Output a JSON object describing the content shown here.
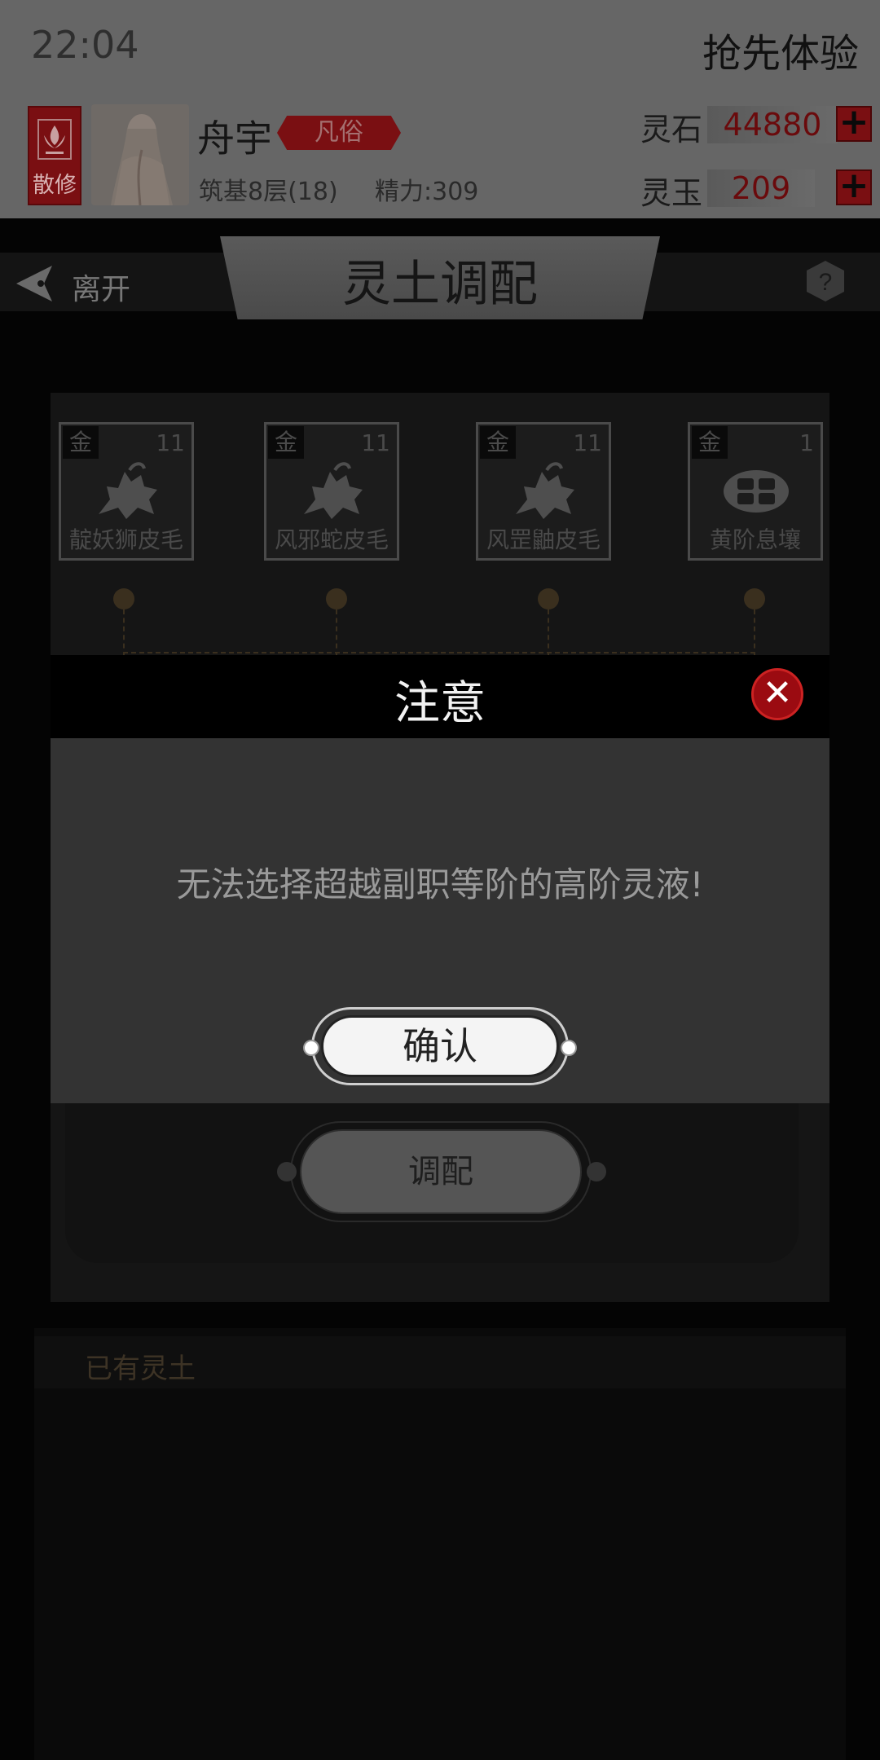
{
  "status": {
    "time": "22:04",
    "preview_label": "抢先体验"
  },
  "player": {
    "sect": "散修",
    "name": "舟宇",
    "rank": "凡俗",
    "realm": "筑基8层(18)",
    "energy": "精力:309"
  },
  "currency": [
    {
      "label": "灵石",
      "value": "44880"
    },
    {
      "label": "灵玉",
      "value": "209"
    }
  ],
  "header": {
    "back_label": "离开",
    "title": "灵土调配",
    "help_icon": "question-icon"
  },
  "slots": [
    {
      "grade": "金",
      "count": "11",
      "name": "靛妖狮皮毛",
      "icon": "beast-pelt-icon"
    },
    {
      "grade": "金",
      "count": "11",
      "name": "风邪蛇皮毛",
      "icon": "beast-pelt-icon"
    },
    {
      "grade": "金",
      "count": "11",
      "name": "风罡鼬皮毛",
      "icon": "beast-pelt-icon"
    },
    {
      "grade": "金",
      "count": "1",
      "name": "黄阶息壤",
      "icon": "soil-block-icon"
    }
  ],
  "mix_button": "调配",
  "owned": {
    "title": "已有灵土"
  },
  "modal": {
    "title": "注意",
    "message": "无法选择超越副职等阶的高阶灵液!",
    "confirm": "确认",
    "close_icon": "close-icon"
  },
  "colors": {
    "accent_red": "#9b0b11",
    "overlay": "#000000"
  }
}
